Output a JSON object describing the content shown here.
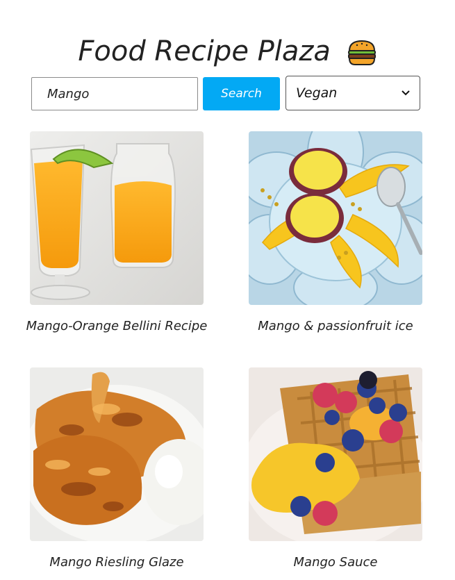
{
  "header": {
    "title": "Food Recipe Plaza",
    "icon": "burger-icon"
  },
  "search": {
    "value": "Mango",
    "button_label": "Search"
  },
  "filter": {
    "selected": "Vegan"
  },
  "colors": {
    "accent": "#03a9f4",
    "text": "#222222"
  },
  "recipes": [
    {
      "name": "Mango-Orange Bellini Recipe",
      "image": "mango-orange-drink-image"
    },
    {
      "name": "Mango & passionfruit ice",
      "image": "mango-passionfruit-plate-image"
    },
    {
      "name": "Mango Riesling Glaze",
      "image": "glazed-chicken-rice-image"
    },
    {
      "name": "Mango Sauce",
      "image": "waffles-berries-mango-image"
    }
  ]
}
